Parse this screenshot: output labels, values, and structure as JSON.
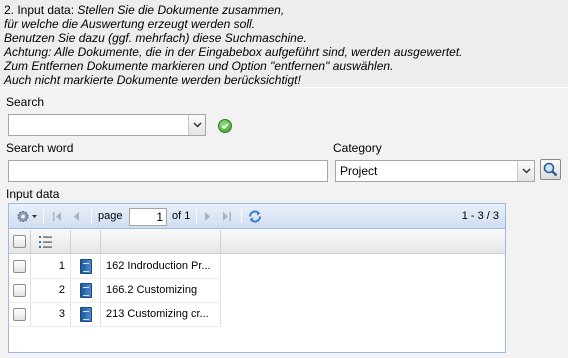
{
  "info": {
    "lines": [
      {
        "prefix": "2. Input data: ",
        "text": "Stellen Sie die Dokumente zusammen,"
      },
      {
        "prefix": "",
        "text": "für welche die Auswertung erzeugt werden soll."
      },
      {
        "prefix": "",
        "text": "Benutzen Sie dazu (ggf. mehrfach) diese Suchmaschine."
      },
      {
        "prefix": "",
        "text": "Achtung: Alle Dokumente, die in der Eingabebox aufgeführt sind, werden ausgewertet."
      },
      {
        "prefix": "",
        "text": "Zum Entfernen Dokumente markieren und Option \"entfernen\" auswählen."
      },
      {
        "prefix": "",
        "text": "Auch nicht markierte Dokumente werden berücksichtigt!"
      }
    ]
  },
  "search": {
    "label": "Search",
    "value": ""
  },
  "search_word": {
    "label": "Search word",
    "value": ""
  },
  "category": {
    "label": "Category",
    "value": "Project"
  },
  "input_data": {
    "label": "Input data",
    "toolbar": {
      "page_label": "page",
      "page_value": "1",
      "of_label": "of 1",
      "range": "1 - 3 / 3"
    },
    "rows": [
      {
        "num": "1",
        "title": "162 Indroduction Pr..."
      },
      {
        "num": "2",
        "title": "166.2 Customizing"
      },
      {
        "num": "3",
        "title": "213 Customizing cr..."
      }
    ]
  },
  "icons": {
    "ok": "check-circle-icon",
    "search": "magnifier-icon",
    "gear": "gear-icon",
    "refresh": "refresh-icon",
    "document": "document-icon"
  },
  "colors": {
    "grid_border": "#99bbe8",
    "toolbar_bg": "#d0def0",
    "ok_green": "#3a9a2a",
    "doc_blue": "#1f5a9c"
  }
}
